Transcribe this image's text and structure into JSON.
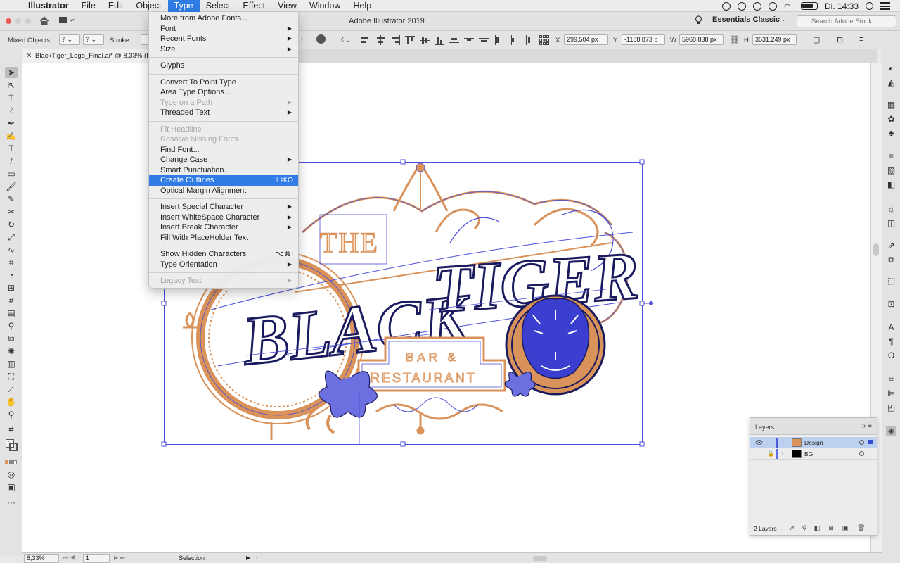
{
  "menubar": {
    "app": "Illustrator",
    "items": [
      "File",
      "Edit",
      "Object",
      "Type",
      "Select",
      "Effect",
      "View",
      "Window",
      "Help"
    ],
    "active": "Type",
    "clock": "Di. 14:33"
  },
  "appbar": {
    "title": "Adobe Illustrator 2019",
    "workspace": "Essentials Classic",
    "search_placeholder": "Search Adobe Stock"
  },
  "controlbar": {
    "selection_label": "Mixed Objects",
    "stroke_label": "Stroke:",
    "x_label": "X:",
    "x_value": "299,504 px",
    "y_label": "Y:",
    "y_value": "-1188,873 p",
    "w_label": "W:",
    "w_value": "5968,838 px",
    "h_label": "H:",
    "h_value": "3531,249 px"
  },
  "document": {
    "tab_label": "BlackTiger_Logo_Final.ai* @ 8,33% (RGB/G"
  },
  "type_menu": {
    "items": [
      {
        "label": "More from Adobe Fonts...",
        "state": "enabled"
      },
      {
        "label": "Font",
        "state": "enabled",
        "submenu": true
      },
      {
        "label": "Recent Fonts",
        "state": "enabled",
        "submenu": true
      },
      {
        "label": "Size",
        "state": "enabled",
        "submenu": true
      },
      {
        "sep": true
      },
      {
        "label": "Glyphs",
        "state": "enabled"
      },
      {
        "sep": true
      },
      {
        "label": "Convert To Point Type",
        "state": "enabled"
      },
      {
        "label": "Area Type Options...",
        "state": "enabled"
      },
      {
        "label": "Type on a Path",
        "state": "disabled",
        "submenu": true
      },
      {
        "label": "Threaded Text",
        "state": "enabled",
        "submenu": true
      },
      {
        "sep": true
      },
      {
        "label": "Fit Headline",
        "state": "disabled"
      },
      {
        "label": "Resolve Missing Fonts...",
        "state": "disabled"
      },
      {
        "label": "Find Font...",
        "state": "enabled"
      },
      {
        "label": "Change Case",
        "state": "enabled",
        "submenu": true
      },
      {
        "label": "Smart Punctuation...",
        "state": "enabled"
      },
      {
        "label": "Create Outlines",
        "state": "highlighted",
        "shortcut": "⇧⌘O"
      },
      {
        "label": "Optical Margin Alignment",
        "state": "enabled"
      },
      {
        "sep": true
      },
      {
        "label": "Insert Special Character",
        "state": "enabled",
        "submenu": true
      },
      {
        "label": "Insert WhiteSpace Character",
        "state": "enabled",
        "submenu": true
      },
      {
        "label": "Insert Break Character",
        "state": "enabled",
        "submenu": true
      },
      {
        "label": "Fill With PlaceHolder Text",
        "state": "enabled"
      },
      {
        "sep": true
      },
      {
        "label": "Show Hidden Characters",
        "state": "enabled",
        "shortcut": "⌥⌘I"
      },
      {
        "label": "Type Orientation",
        "state": "enabled",
        "submenu": true
      },
      {
        "sep": true
      },
      {
        "label": "Legacy Text",
        "state": "disabled",
        "submenu": true
      }
    ]
  },
  "artwork": {
    "the": "THE",
    "black": "BLACK",
    "tiger": "TIGER",
    "bar": "BAR &",
    "restaurant": "RESTAURANT"
  },
  "layers_panel": {
    "title": "Layers",
    "layers": [
      {
        "name": "Design",
        "selected": true,
        "locked": false,
        "visible": true
      },
      {
        "name": "BG",
        "selected": false,
        "locked": true,
        "visible": false
      }
    ],
    "count_label": "2 Layers"
  },
  "statusbar": {
    "zoom": "8,33%",
    "artboard": "1",
    "tool": "Selection"
  },
  "colors": {
    "accent": "#2f7ce6",
    "art_orange": "#d9925a",
    "selection_blue": "#4a4fd9",
    "navy": "#1a1a5e"
  }
}
